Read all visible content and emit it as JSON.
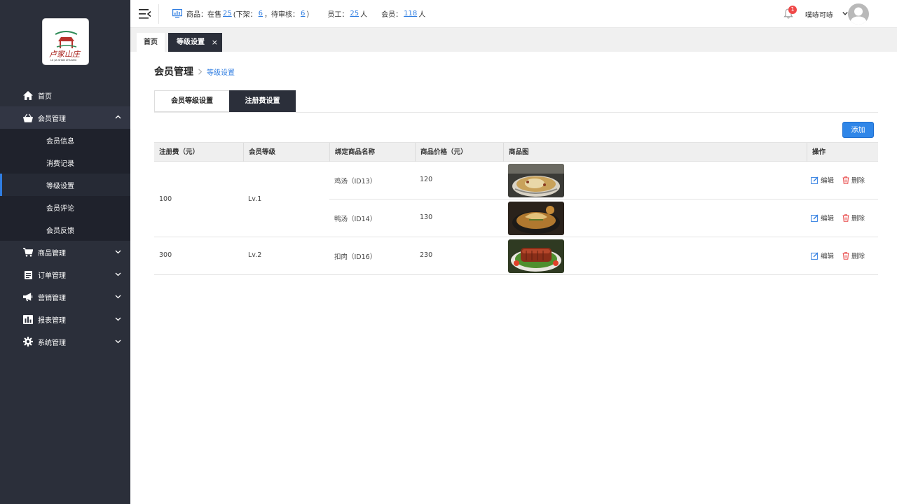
{
  "sidebar": {
    "logo_alt": "卢家山庄",
    "items": [
      {
        "label": "首页",
        "icon": "home-icon"
      },
      {
        "label": "会员管理",
        "icon": "basket-icon",
        "expanded": true,
        "children": [
          {
            "label": "会员信息"
          },
          {
            "label": "消费记录"
          },
          {
            "label": "等级设置",
            "active": true
          },
          {
            "label": "会员评论"
          },
          {
            "label": "会员反馈"
          }
        ]
      },
      {
        "label": "商品管理",
        "icon": "cart-icon"
      },
      {
        "label": "订单管理",
        "icon": "clipboard-icon"
      },
      {
        "label": "营销管理",
        "icon": "megaphone-icon"
      },
      {
        "label": "报表管理",
        "icon": "bar-chart-icon"
      },
      {
        "label": "系统管理",
        "icon": "gear-icon"
      }
    ]
  },
  "topbar": {
    "stats": {
      "goods_label": "商品：在售",
      "on_sale": "25",
      "off_label": "(下架：",
      "off": "6",
      "pending_label": "，待审核：",
      "pending": "6",
      "close_paren": "）",
      "staff_label": "员工：",
      "staff": "25",
      "staff_unit": "人",
      "member_label": "会员：",
      "members": "118",
      "member_unit": "人"
    },
    "notifications": "1",
    "username": "噗哧可哧"
  },
  "page_tabs": {
    "home": "首页",
    "current": "等级设置",
    "close": "×"
  },
  "breadcrumb": {
    "title": "会员管理",
    "current": "等级设置"
  },
  "segments": {
    "level": "会员等级设置",
    "fee": "注册费设置"
  },
  "add_label": "添加",
  "table": {
    "headers": [
      "注册费（元）",
      "会员等级",
      "绑定商品名称",
      "商品价格（元）",
      "商品图",
      "操作"
    ],
    "edit_label": "编辑",
    "delete_label": "删除",
    "groups": [
      {
        "fee": "100",
        "level": "Lv.1",
        "items": [
          {
            "name": "鸡汤（ID13）",
            "price": "120",
            "image": "chicken-soup"
          },
          {
            "name": "鸭汤（ID14）",
            "price": "130",
            "image": "duck-soup"
          }
        ]
      },
      {
        "fee": "300",
        "level": "Lv.2",
        "items": [
          {
            "name": "扣肉（ID16）",
            "price": "230",
            "image": "braised-pork"
          }
        ]
      }
    ]
  }
}
